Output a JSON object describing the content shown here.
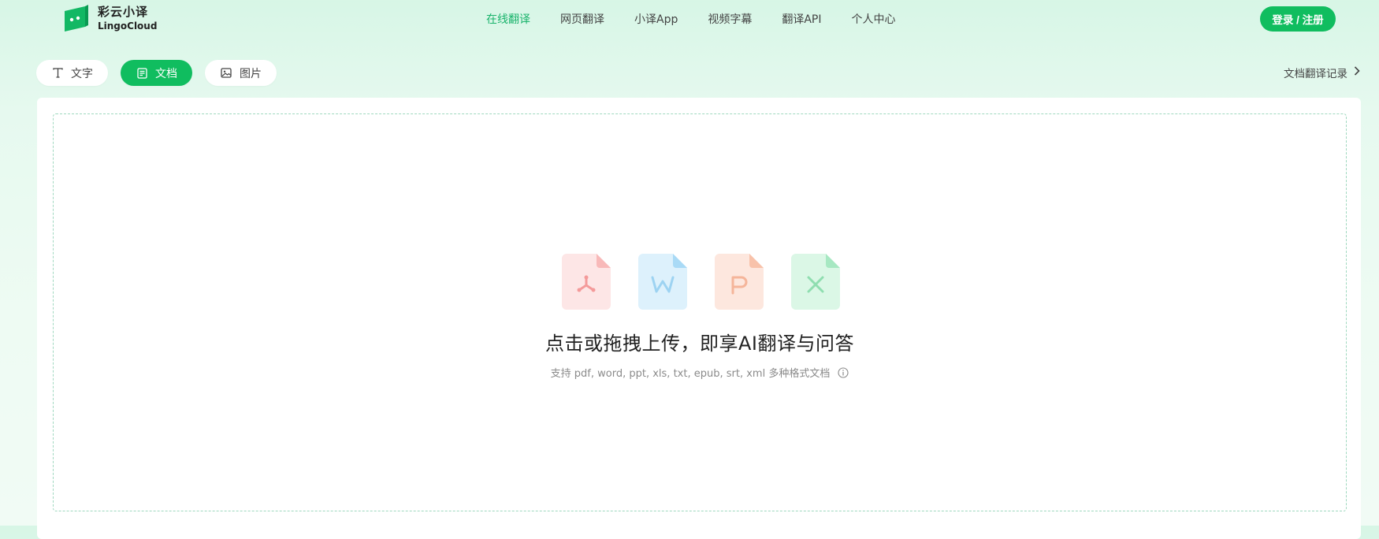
{
  "header": {
    "logo_cn": "彩云小译",
    "logo_en": "LingoCloud",
    "nav": [
      {
        "label": "在线翻译",
        "active": true
      },
      {
        "label": "网页翻译"
      },
      {
        "label": "小译App"
      },
      {
        "label": "视频字幕"
      },
      {
        "label": "翻译API"
      },
      {
        "label": "个人中心"
      }
    ],
    "login_label": "登录 / 注册"
  },
  "tabs": [
    {
      "label": "文字",
      "icon": "text-icon"
    },
    {
      "label": "文档",
      "icon": "document-icon",
      "active": true
    },
    {
      "label": "图片",
      "icon": "image-icon"
    }
  ],
  "history_label": "文档翻译记录",
  "upload": {
    "file_types": [
      "pdf-icon",
      "word-icon",
      "ppt-icon",
      "excel-icon"
    ],
    "headline": "点击或拖拽上传，即享AI翻译与问答",
    "support_text": "支持 pdf, word, ppt, xls, txt, epub, srt, xml 多种格式文档"
  },
  "colors": {
    "accent": "#10bd5f",
    "nav_active": "#19b36b",
    "pdf": "#f26a6a",
    "word": "#4fb3f0",
    "ppt": "#f58a5a",
    "excel": "#34c77b"
  }
}
